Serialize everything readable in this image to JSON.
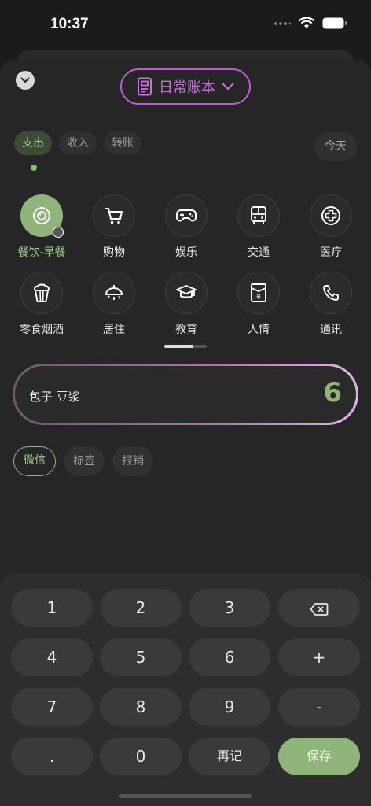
{
  "status": {
    "time": "10:37"
  },
  "ledger": {
    "name": "日常账本"
  },
  "type_tabs": [
    {
      "label": "支出",
      "active": true
    },
    {
      "label": "收入",
      "active": false
    },
    {
      "label": "转账",
      "active": false
    }
  ],
  "today_label": "今天",
  "categories": [
    {
      "label": "餐饮-早餐",
      "icon": "food-icon",
      "selected": true
    },
    {
      "label": "购物",
      "icon": "cart-icon"
    },
    {
      "label": "娱乐",
      "icon": "gamepad-icon"
    },
    {
      "label": "交通",
      "icon": "bus-icon"
    },
    {
      "label": "医疗",
      "icon": "medical-cross-icon"
    },
    {
      "label": "零食烟酒",
      "icon": "popcorn-icon"
    },
    {
      "label": "居住",
      "icon": "ceiling-lamp-icon"
    },
    {
      "label": "教育",
      "icon": "graduation-cap-icon"
    },
    {
      "label": "人情",
      "icon": "red-envelope-icon"
    },
    {
      "label": "通讯",
      "icon": "phone-icon"
    }
  ],
  "category_page_progress": 0.66,
  "entry": {
    "note": "包子 豆浆",
    "amount": "6"
  },
  "chips": [
    {
      "label": "微信",
      "selected": true
    },
    {
      "label": "标签"
    },
    {
      "label": "报销"
    }
  ],
  "keypad": {
    "k1": "1",
    "k2": "2",
    "k3": "3",
    "k4": "4",
    "k5": "5",
    "k6": "6",
    "plus": "+",
    "k7": "7",
    "k8": "8",
    "k9": "9",
    "minus": "-",
    "dot": ".",
    "k0": "0",
    "again": "再记",
    "save": "保存"
  },
  "colors": {
    "accent_green": "#8fb57a",
    "ledger_purple": "#c15bd3",
    "background": "#262626"
  }
}
